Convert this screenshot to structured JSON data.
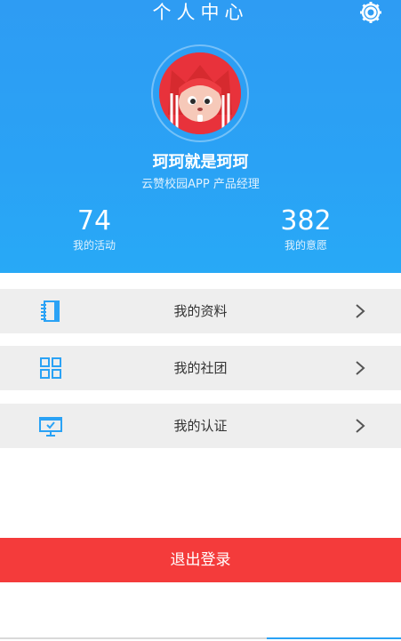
{
  "header": {
    "title": "个人中心",
    "settings_icon": "gear-icon",
    "background": "#2aa2f5"
  },
  "profile": {
    "avatar_icon": "fox-avatar",
    "name": "珂珂就是珂珂",
    "role": "云赞校园APP 产品经理"
  },
  "stats": [
    {
      "value": "74",
      "label": "我的活动"
    },
    {
      "value": "382",
      "label": "我的意愿"
    }
  ],
  "menu": [
    {
      "label": "我的资料",
      "icon": "notebook-icon"
    },
    {
      "label": "我的社团",
      "icon": "grid-icon"
    },
    {
      "label": "我的认证",
      "icon": "monitor-check-icon"
    }
  ],
  "logout": {
    "label": "退出登录",
    "color": "#f43b3b"
  }
}
